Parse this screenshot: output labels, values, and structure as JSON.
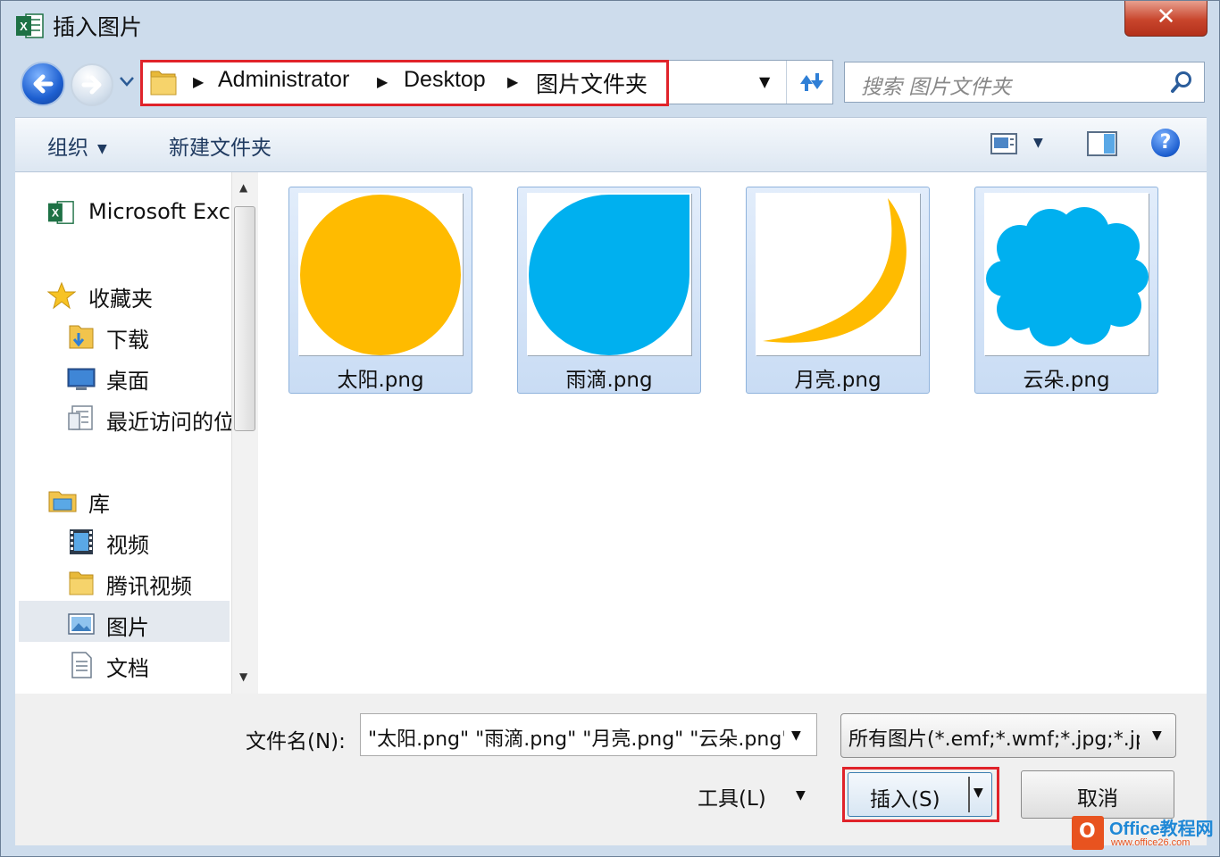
{
  "window": {
    "title": "插入图片",
    "close_label": "✕"
  },
  "address": {
    "breadcrumbs": [
      "Administrator",
      "Desktop",
      "图片文件夹"
    ]
  },
  "search": {
    "placeholder": "搜索 图片文件夹"
  },
  "toolbar": {
    "organize_label": "组织",
    "new_folder_label": "新建文件夹",
    "help_label": "?"
  },
  "sidebar": {
    "items": [
      {
        "label": "Microsoft Exc",
        "icon": "excel-icon"
      },
      {
        "label": "收藏夹",
        "icon": "star-icon"
      },
      {
        "label": "下载",
        "icon": "downloads-folder-icon"
      },
      {
        "label": "桌面",
        "icon": "desktop-icon"
      },
      {
        "label": "最近访问的位",
        "icon": "recent-places-icon"
      },
      {
        "label": "库",
        "icon": "library-icon"
      },
      {
        "label": "视频",
        "icon": "video-library-icon"
      },
      {
        "label": "腾讯视频",
        "icon": "folder-icon"
      },
      {
        "label": "图片",
        "icon": "pictures-library-icon",
        "selected": true
      },
      {
        "label": "文档",
        "icon": "documents-library-icon"
      }
    ]
  },
  "files": [
    {
      "name": "太阳.png",
      "shape": "circle",
      "color": "#ffbb00",
      "selected": true
    },
    {
      "name": "雨滴.png",
      "shape": "teardrop",
      "color": "#00b0ef",
      "selected": true
    },
    {
      "name": "月亮.png",
      "shape": "crescent",
      "color": "#ffbb00",
      "selected": true
    },
    {
      "name": "云朵.png",
      "shape": "cloud",
      "color": "#00b0ef",
      "selected": true
    }
  ],
  "bottom": {
    "filename_label": "文件名(N):",
    "filename_value": "\"太阳.png\" \"雨滴.png\" \"月亮.png\" \"云朵.png\"",
    "filetype_value": "所有图片(*.emf;*.wmf;*.jpg;*.jpeg;*.png)",
    "tools_label": "工具(L)",
    "insert_label": "插入(S)",
    "cancel_label": "取消"
  },
  "watermark": {
    "brand": "Office教程网",
    "url": "www.office26.com"
  },
  "colors": {
    "highlight": "#e0232a",
    "accent": "#1d5fd0"
  }
}
